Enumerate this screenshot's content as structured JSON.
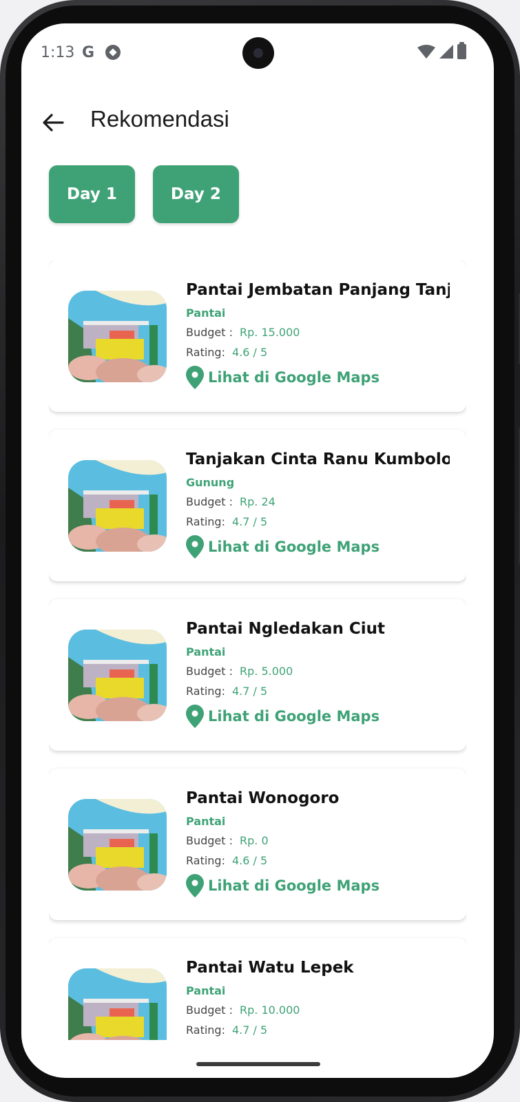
{
  "status_bar": {
    "time": "1:13",
    "g_label": "G",
    "icons": [
      "google-icon",
      "football-icon",
      "wifi-icon",
      "signal-icon",
      "battery-icon"
    ]
  },
  "appbar": {
    "back_icon": "arrow-left-icon",
    "title": "Rekomendasi"
  },
  "days": [
    {
      "label": "Day 1"
    },
    {
      "label": "Day 2"
    }
  ],
  "labels": {
    "budget": "Budget :",
    "rating": "Rating:",
    "maps": "Lihat di Google Maps"
  },
  "places": [
    {
      "name": "Pantai Jembatan Panjang Tanjung",
      "category": "Pantai",
      "budget": "Rp. 15.000",
      "rating": "4.6 / 5"
    },
    {
      "name": "Tanjakan Cinta Ranu Kumbolo",
      "category": "Gunung",
      "budget": "Rp. 24",
      "rating": "4.7 / 5"
    },
    {
      "name": "Pantai Ngledakan Ciut",
      "category": "Pantai",
      "budget": "Rp. 5.000",
      "rating": "4.7 / 5"
    },
    {
      "name": "Pantai Wonogoro",
      "category": "Pantai",
      "budget": "Rp. 0",
      "rating": "4.6 / 5"
    },
    {
      "name": "Pantai Watu Lepek",
      "category": "Pantai",
      "budget": "Rp. 10.000",
      "rating": "4.7 / 5"
    }
  ],
  "colors": {
    "accent": "#3fa276",
    "text": "#111111",
    "background": "#ffffff"
  }
}
